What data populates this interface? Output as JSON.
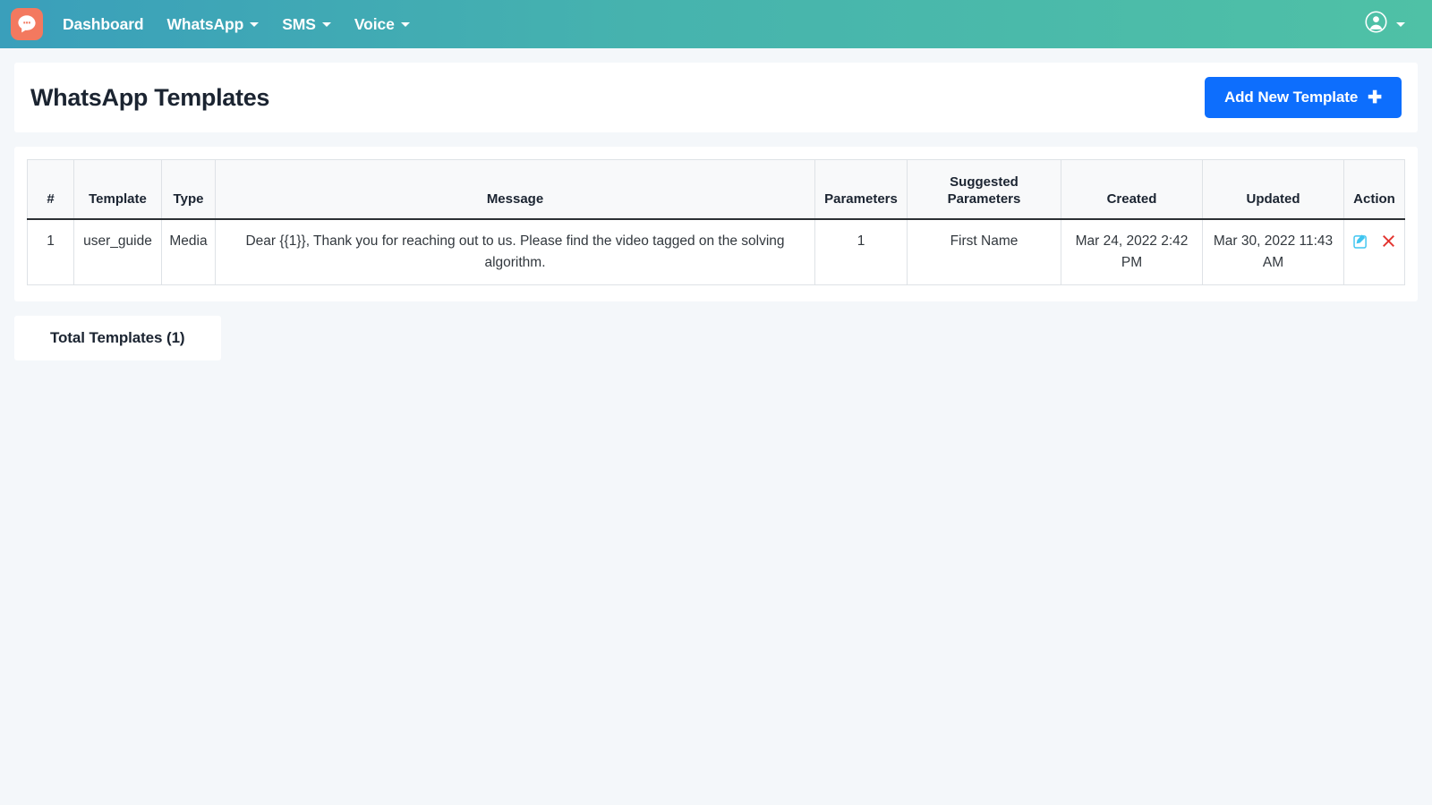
{
  "navbar": {
    "logo_icon": "chat-bubble-logo",
    "logo_bg": "#f3795f",
    "gradient_from": "#3a9fbb",
    "gradient_to": "#4fc1a6",
    "links": [
      {
        "label": "Dashboard",
        "has_caret": false
      },
      {
        "label": "WhatsApp",
        "has_caret": true
      },
      {
        "label": "SMS",
        "has_caret": true
      },
      {
        "label": "Voice",
        "has_caret": true
      }
    ],
    "account": {
      "icon": "user-circle-icon",
      "has_caret": true
    }
  },
  "header": {
    "title": "WhatsApp Templates",
    "add_button": {
      "label": "Add New Template",
      "icon": "plus-icon",
      "color": "#0d6efd"
    }
  },
  "table": {
    "columns": [
      "#",
      "Template",
      "Type",
      "Message",
      "Parameters",
      "Suggested Parameters",
      "Created",
      "Updated",
      "Action"
    ],
    "rows": [
      {
        "index": "1",
        "template": "user_guide",
        "type": "Media",
        "message": "Dear {{1}}, Thank you for reaching out to us. Please find the video tagged on the solving algorithm.",
        "parameters": "1",
        "suggested_parameters": "First Name",
        "created": "Mar 24, 2022 2:42 PM",
        "updated": "Mar 30, 2022 11:43 AM",
        "actions": {
          "edit": {
            "icon": "edit-pencil-square-icon",
            "color": "#3fc5f0"
          },
          "delete": {
            "icon": "delete-times-icon",
            "color": "#e3342f"
          }
        }
      }
    ]
  },
  "footer": {
    "total_label": "Total Templates (1)"
  }
}
